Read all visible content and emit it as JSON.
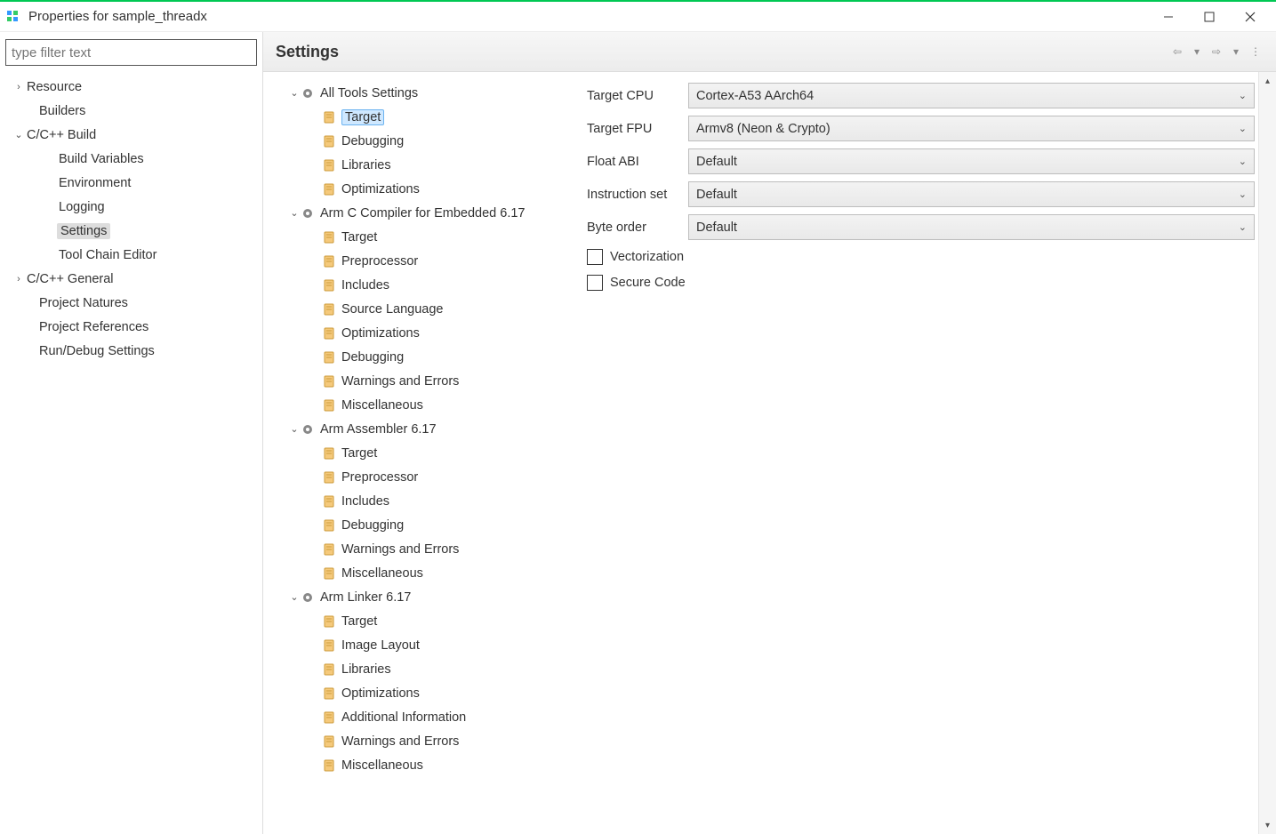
{
  "titlebar": {
    "title": "Properties for sample_threadx"
  },
  "filter": {
    "placeholder": "type filter text"
  },
  "nav": {
    "items": [
      {
        "label": "Resource",
        "expandable": true,
        "expanded": false,
        "indent": 0
      },
      {
        "label": "Builders",
        "expandable": false,
        "indent": 0,
        "pad": true
      },
      {
        "label": "C/C++ Build",
        "expandable": true,
        "expanded": true,
        "indent": 0
      },
      {
        "label": "Build Variables",
        "indent": 1
      },
      {
        "label": "Environment",
        "indent": 1
      },
      {
        "label": "Logging",
        "indent": 1
      },
      {
        "label": "Settings",
        "indent": 1,
        "selected": true
      },
      {
        "label": "Tool Chain Editor",
        "indent": 1
      },
      {
        "label": "C/C++ General",
        "expandable": true,
        "expanded": false,
        "indent": 0
      },
      {
        "label": "Project Natures",
        "indent": 0,
        "pad": true
      },
      {
        "label": "Project References",
        "indent": 0,
        "pad": true
      },
      {
        "label": "Run/Debug Settings",
        "indent": 0,
        "pad": true
      }
    ]
  },
  "header": {
    "title": "Settings"
  },
  "tooltree": [
    {
      "label": "All Tools Settings",
      "level": 0,
      "icon": "gear",
      "expandable": true,
      "expanded": true
    },
    {
      "label": "Target",
      "level": 1,
      "icon": "page",
      "selected": true
    },
    {
      "label": "Debugging",
      "level": 1,
      "icon": "page"
    },
    {
      "label": "Libraries",
      "level": 1,
      "icon": "page"
    },
    {
      "label": "Optimizations",
      "level": 1,
      "icon": "page"
    },
    {
      "label": "Arm C Compiler for Embedded 6.17",
      "level": 0,
      "icon": "gear",
      "expandable": true,
      "expanded": true
    },
    {
      "label": "Target",
      "level": 1,
      "icon": "page"
    },
    {
      "label": "Preprocessor",
      "level": 1,
      "icon": "page"
    },
    {
      "label": "Includes",
      "level": 1,
      "icon": "page"
    },
    {
      "label": "Source Language",
      "level": 1,
      "icon": "page"
    },
    {
      "label": "Optimizations",
      "level": 1,
      "icon": "page"
    },
    {
      "label": "Debugging",
      "level": 1,
      "icon": "page"
    },
    {
      "label": "Warnings and Errors",
      "level": 1,
      "icon": "page"
    },
    {
      "label": "Miscellaneous",
      "level": 1,
      "icon": "page"
    },
    {
      "label": "Arm Assembler 6.17",
      "level": 0,
      "icon": "gear",
      "expandable": true,
      "expanded": true
    },
    {
      "label": "Target",
      "level": 1,
      "icon": "page"
    },
    {
      "label": "Preprocessor",
      "level": 1,
      "icon": "page"
    },
    {
      "label": "Includes",
      "level": 1,
      "icon": "page"
    },
    {
      "label": "Debugging",
      "level": 1,
      "icon": "page"
    },
    {
      "label": "Warnings and Errors",
      "level": 1,
      "icon": "page"
    },
    {
      "label": "Miscellaneous",
      "level": 1,
      "icon": "page"
    },
    {
      "label": "Arm Linker 6.17",
      "level": 0,
      "icon": "gear",
      "expandable": true,
      "expanded": true
    },
    {
      "label": "Target",
      "level": 1,
      "icon": "page"
    },
    {
      "label": "Image Layout",
      "level": 1,
      "icon": "page"
    },
    {
      "label": "Libraries",
      "level": 1,
      "icon": "page"
    },
    {
      "label": "Optimizations",
      "level": 1,
      "icon": "page"
    },
    {
      "label": "Additional Information",
      "level": 1,
      "icon": "page"
    },
    {
      "label": "Warnings and Errors",
      "level": 1,
      "icon": "page"
    },
    {
      "label": "Miscellaneous",
      "level": 1,
      "icon": "page"
    }
  ],
  "form": {
    "rows": [
      {
        "label": "Target CPU",
        "value": "Cortex-A53 AArch64"
      },
      {
        "label": "Target FPU",
        "value": "Armv8 (Neon & Crypto)"
      },
      {
        "label": "Float ABI",
        "value": "Default"
      },
      {
        "label": "Instruction set",
        "value": "Default"
      },
      {
        "label": "Byte order",
        "value": "Default"
      }
    ],
    "checks": [
      {
        "label": "Vectorization",
        "checked": false
      },
      {
        "label": "Secure Code",
        "checked": false
      }
    ]
  }
}
